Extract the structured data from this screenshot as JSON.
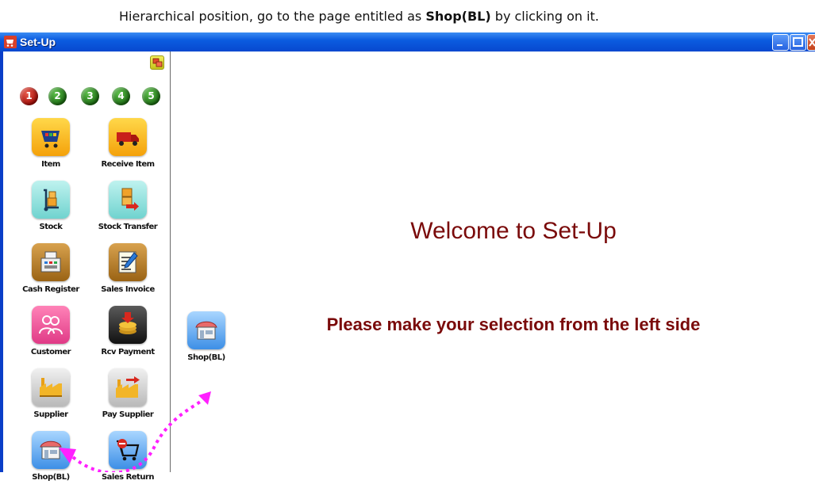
{
  "caption": {
    "prefix": "Hierarchical position, go to the page entitled as",
    "bold": "Shop(BL)",
    "suffix": "by clicking on it."
  },
  "window": {
    "title": "Set-Up",
    "title_icon": "shopping-cart-icon",
    "controls": [
      "minimize",
      "maximize",
      "close"
    ]
  },
  "sidebar": {
    "top_button_icon": "windows-switch-icon",
    "steps": [
      {
        "label": "1",
        "color": "#c0120c",
        "active": true
      },
      {
        "label": "2",
        "color": "#2a8a1c",
        "active": false
      },
      {
        "label": "3",
        "color": "#2a8a1c",
        "active": false
      },
      {
        "label": "4",
        "color": "#2a8a1c",
        "active": false
      },
      {
        "label": "5",
        "color": "#2a8a1c",
        "active": false
      }
    ],
    "items": [
      {
        "label": "Item",
        "icon": "shopping-cart-icon"
      },
      {
        "label": "Receive Item",
        "icon": "delivery-truck-icon"
      },
      {
        "label": "Stock",
        "icon": "hand-truck-icon"
      },
      {
        "label": "Stock Transfer",
        "icon": "box-transfer-icon"
      },
      {
        "label": "Cash Register",
        "icon": "cash-register-icon"
      },
      {
        "label": "Sales Invoice",
        "icon": "invoice-pen-icon"
      },
      {
        "label": "Customer",
        "icon": "users-icon"
      },
      {
        "label": "Rcv Payment",
        "icon": "coins-icon"
      },
      {
        "label": "Supplier",
        "icon": "factory-icon"
      },
      {
        "label": "Pay Supplier",
        "icon": "factory-arrow-icon"
      },
      {
        "label": "Shop(BL)",
        "icon": "shop-icon"
      },
      {
        "label": "Sales Return",
        "icon": "cart-return-icon"
      }
    ]
  },
  "main": {
    "welcome": "Welcome to Set-Up",
    "prompt": "Please make your selection from the left side",
    "drag_target": {
      "label": "Shop(BL)",
      "icon": "shop-icon"
    }
  },
  "annotation": {
    "arrow_color": "#ff20ff"
  }
}
